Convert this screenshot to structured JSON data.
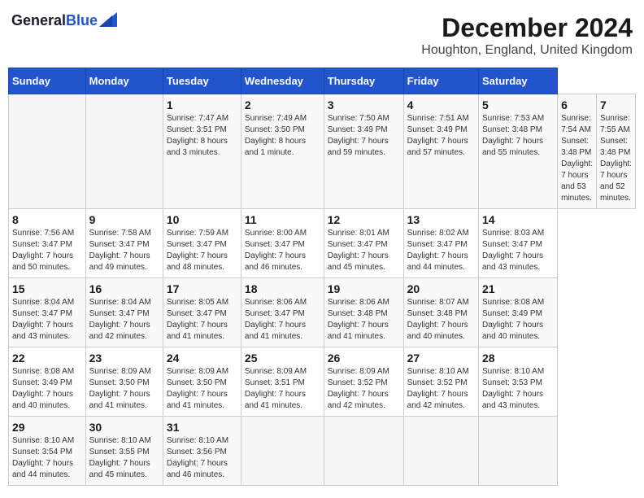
{
  "header": {
    "logo_line1": "General",
    "logo_line2": "Blue",
    "main_title": "December 2024",
    "subtitle": "Houghton, England, United Kingdom"
  },
  "calendar": {
    "days_of_week": [
      "Sunday",
      "Monday",
      "Tuesday",
      "Wednesday",
      "Thursday",
      "Friday",
      "Saturday"
    ],
    "weeks": [
      [
        null,
        null,
        {
          "day": "1",
          "sunrise": "Sunrise: 7:47 AM",
          "sunset": "Sunset: 3:51 PM",
          "daylight": "Daylight: 8 hours and 3 minutes."
        },
        {
          "day": "2",
          "sunrise": "Sunrise: 7:49 AM",
          "sunset": "Sunset: 3:50 PM",
          "daylight": "Daylight: 8 hours and 1 minute."
        },
        {
          "day": "3",
          "sunrise": "Sunrise: 7:50 AM",
          "sunset": "Sunset: 3:49 PM",
          "daylight": "Daylight: 7 hours and 59 minutes."
        },
        {
          "day": "4",
          "sunrise": "Sunrise: 7:51 AM",
          "sunset": "Sunset: 3:49 PM",
          "daylight": "Daylight: 7 hours and 57 minutes."
        },
        {
          "day": "5",
          "sunrise": "Sunrise: 7:53 AM",
          "sunset": "Sunset: 3:48 PM",
          "daylight": "Daylight: 7 hours and 55 minutes."
        },
        {
          "day": "6",
          "sunrise": "Sunrise: 7:54 AM",
          "sunset": "Sunset: 3:48 PM",
          "daylight": "Daylight: 7 hours and 53 minutes."
        },
        {
          "day": "7",
          "sunrise": "Sunrise: 7:55 AM",
          "sunset": "Sunset: 3:48 PM",
          "daylight": "Daylight: 7 hours and 52 minutes."
        }
      ],
      [
        {
          "day": "8",
          "sunrise": "Sunrise: 7:56 AM",
          "sunset": "Sunset: 3:47 PM",
          "daylight": "Daylight: 7 hours and 50 minutes."
        },
        {
          "day": "9",
          "sunrise": "Sunrise: 7:58 AM",
          "sunset": "Sunset: 3:47 PM",
          "daylight": "Daylight: 7 hours and 49 minutes."
        },
        {
          "day": "10",
          "sunrise": "Sunrise: 7:59 AM",
          "sunset": "Sunset: 3:47 PM",
          "daylight": "Daylight: 7 hours and 48 minutes."
        },
        {
          "day": "11",
          "sunrise": "Sunrise: 8:00 AM",
          "sunset": "Sunset: 3:47 PM",
          "daylight": "Daylight: 7 hours and 46 minutes."
        },
        {
          "day": "12",
          "sunrise": "Sunrise: 8:01 AM",
          "sunset": "Sunset: 3:47 PM",
          "daylight": "Daylight: 7 hours and 45 minutes."
        },
        {
          "day": "13",
          "sunrise": "Sunrise: 8:02 AM",
          "sunset": "Sunset: 3:47 PM",
          "daylight": "Daylight: 7 hours and 44 minutes."
        },
        {
          "day": "14",
          "sunrise": "Sunrise: 8:03 AM",
          "sunset": "Sunset: 3:47 PM",
          "daylight": "Daylight: 7 hours and 43 minutes."
        }
      ],
      [
        {
          "day": "15",
          "sunrise": "Sunrise: 8:04 AM",
          "sunset": "Sunset: 3:47 PM",
          "daylight": "Daylight: 7 hours and 43 minutes."
        },
        {
          "day": "16",
          "sunrise": "Sunrise: 8:04 AM",
          "sunset": "Sunset: 3:47 PM",
          "daylight": "Daylight: 7 hours and 42 minutes."
        },
        {
          "day": "17",
          "sunrise": "Sunrise: 8:05 AM",
          "sunset": "Sunset: 3:47 PM",
          "daylight": "Daylight: 7 hours and 41 minutes."
        },
        {
          "day": "18",
          "sunrise": "Sunrise: 8:06 AM",
          "sunset": "Sunset: 3:47 PM",
          "daylight": "Daylight: 7 hours and 41 minutes."
        },
        {
          "day": "19",
          "sunrise": "Sunrise: 8:06 AM",
          "sunset": "Sunset: 3:48 PM",
          "daylight": "Daylight: 7 hours and 41 minutes."
        },
        {
          "day": "20",
          "sunrise": "Sunrise: 8:07 AM",
          "sunset": "Sunset: 3:48 PM",
          "daylight": "Daylight: 7 hours and 40 minutes."
        },
        {
          "day": "21",
          "sunrise": "Sunrise: 8:08 AM",
          "sunset": "Sunset: 3:49 PM",
          "daylight": "Daylight: 7 hours and 40 minutes."
        }
      ],
      [
        {
          "day": "22",
          "sunrise": "Sunrise: 8:08 AM",
          "sunset": "Sunset: 3:49 PM",
          "daylight": "Daylight: 7 hours and 40 minutes."
        },
        {
          "day": "23",
          "sunrise": "Sunrise: 8:09 AM",
          "sunset": "Sunset: 3:50 PM",
          "daylight": "Daylight: 7 hours and 41 minutes."
        },
        {
          "day": "24",
          "sunrise": "Sunrise: 8:09 AM",
          "sunset": "Sunset: 3:50 PM",
          "daylight": "Daylight: 7 hours and 41 minutes."
        },
        {
          "day": "25",
          "sunrise": "Sunrise: 8:09 AM",
          "sunset": "Sunset: 3:51 PM",
          "daylight": "Daylight: 7 hours and 41 minutes."
        },
        {
          "day": "26",
          "sunrise": "Sunrise: 8:09 AM",
          "sunset": "Sunset: 3:52 PM",
          "daylight": "Daylight: 7 hours and 42 minutes."
        },
        {
          "day": "27",
          "sunrise": "Sunrise: 8:10 AM",
          "sunset": "Sunset: 3:52 PM",
          "daylight": "Daylight: 7 hours and 42 minutes."
        },
        {
          "day": "28",
          "sunrise": "Sunrise: 8:10 AM",
          "sunset": "Sunset: 3:53 PM",
          "daylight": "Daylight: 7 hours and 43 minutes."
        }
      ],
      [
        {
          "day": "29",
          "sunrise": "Sunrise: 8:10 AM",
          "sunset": "Sunset: 3:54 PM",
          "daylight": "Daylight: 7 hours and 44 minutes."
        },
        {
          "day": "30",
          "sunrise": "Sunrise: 8:10 AM",
          "sunset": "Sunset: 3:55 PM",
          "daylight": "Daylight: 7 hours and 45 minutes."
        },
        {
          "day": "31",
          "sunrise": "Sunrise: 8:10 AM",
          "sunset": "Sunset: 3:56 PM",
          "daylight": "Daylight: 7 hours and 46 minutes."
        },
        null,
        null,
        null,
        null
      ]
    ]
  }
}
